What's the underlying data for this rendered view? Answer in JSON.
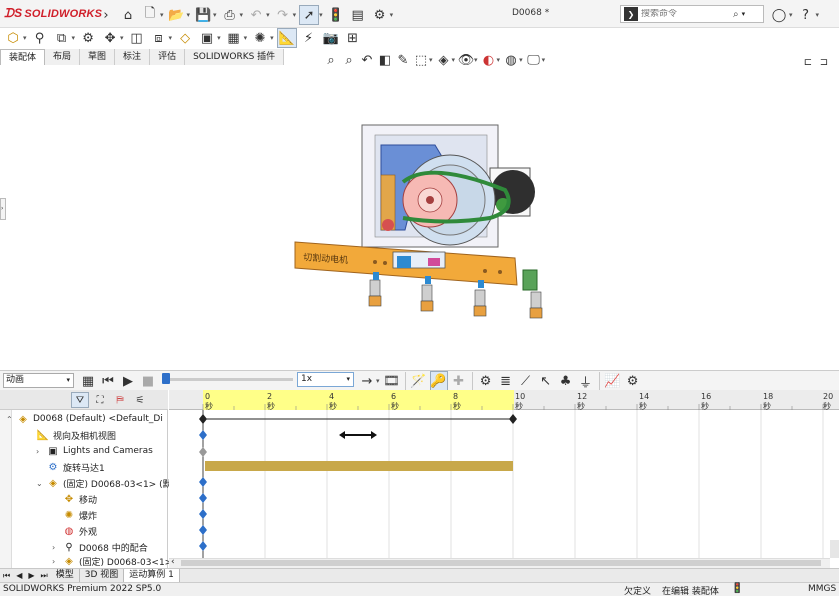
{
  "app": {
    "logo_text": "SOLIDWORKS",
    "doc_title": "D0068 *"
  },
  "search": {
    "placeholder": "搜索命令"
  },
  "cmd_tabs": [
    "装配体",
    "布局",
    "草图",
    "标注",
    "评估",
    "SOLIDWORKS 插件"
  ],
  "motion": {
    "study_type": "动画",
    "speed": "1x",
    "ruler_ticks": [
      "0 秒",
      "2 秒",
      "4 秒",
      "6 秒",
      "8 秒",
      "10 秒",
      "12 秒",
      "14 秒",
      "16 秒",
      "18 秒",
      "20 秒"
    ]
  },
  "tree": {
    "items": [
      {
        "label": "D0068 (Default) <Default_Di",
        "icon": "assembly-icon"
      },
      {
        "label": "视向及相机视图",
        "icon": "camera-icon"
      },
      {
        "label": "Lights and Cameras",
        "icon": "lights-icon"
      },
      {
        "label": "旋转马达1",
        "icon": "motor-icon"
      },
      {
        "label": "(固定) D0068-03<1> (默认",
        "icon": "subassembly-icon"
      },
      {
        "label": "移动",
        "icon": "move-icon"
      },
      {
        "label": "爆炸",
        "icon": "explode-icon"
      },
      {
        "label": "外观",
        "icon": "appearance-icon"
      },
      {
        "label": "D0068 中的配合",
        "icon": "mates-icon"
      },
      {
        "label": "(固定) D0068-03<1>",
        "icon": "subassembly-icon"
      }
    ]
  },
  "bottom_tabs": [
    "模型",
    "3D 视图",
    "运动算例 1"
  ],
  "status": {
    "version": "SOLIDWORKS Premium 2022 SP5.0",
    "defined": "欠定义",
    "editing": "在编辑 装配体",
    "units": "MMGS"
  },
  "colors": {
    "brand": "#d01f2a",
    "ruler_highlight": "#ffff88",
    "motor_bar": "#c8a84a"
  }
}
